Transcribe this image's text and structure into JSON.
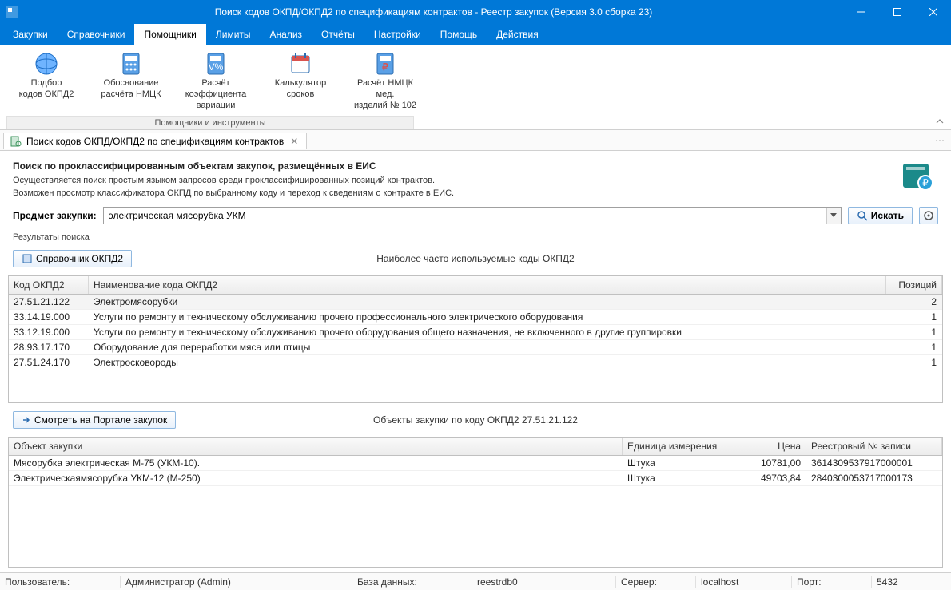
{
  "window": {
    "title": "Поиск кодов ОКПД/ОКПД2 по спецификациям контрактов - Реестр закупок (Версия 3.0 сборка 23)"
  },
  "menu": {
    "items": [
      "Закупки",
      "Справочники",
      "Помощники",
      "Лимиты",
      "Анализ",
      "Отчёты",
      "Настройки",
      "Помощь",
      "Действия"
    ],
    "active_index": 2
  },
  "ribbon": {
    "group_label": "Помощники и инструменты",
    "buttons": [
      {
        "label": "Подбор\nкодов ОКПД2"
      },
      {
        "label": "Обоснование\nрасчёта НМЦК"
      },
      {
        "label": "Расчёт коэффициента\nвариации"
      },
      {
        "label": "Калькулятор\nсроков"
      },
      {
        "label": "Расчёт НМЦК мед.\nизделий № 102"
      }
    ]
  },
  "tab": {
    "label": "Поиск кодов ОКПД/ОКПД2 по спецификациям контрактов"
  },
  "header": {
    "title": "Поиск по проклассифицированным объектам закупок, размещённых в ЕИС",
    "desc1": "Осуществляется поиск простым языком запросов среди проклассифицированных позиций контрактов.",
    "desc2": "Возможен просмотр классификатора ОКПД по выбранному коду и переход к сведениям о контракте в ЕИС."
  },
  "search": {
    "label": "Предмет закупки:",
    "value": "электрическая мясорубка УКМ",
    "button": "Искать"
  },
  "results": {
    "label": "Результаты поиска",
    "ref_button": "Справочник ОКПД2",
    "freq_label": "Наиболее часто используемые коды ОКПД2",
    "columns": {
      "code": "Код ОКПД2",
      "name": "Наименование кода ОКПД2",
      "pos": "Позиций"
    },
    "rows": [
      {
        "code": "27.51.21.122",
        "name": "Электромясорубки",
        "pos": "2"
      },
      {
        "code": "33.14.19.000",
        "name": "Услуги по ремонту и техническому обслуживанию прочего профессионального электрического оборудования",
        "pos": "1"
      },
      {
        "code": "33.12.19.000",
        "name": "Услуги по ремонту и техническому обслуживанию прочего оборудования общего назначения, не включенного в другие группировки",
        "pos": "1"
      },
      {
        "code": "28.93.17.170",
        "name": "Оборудование для переработки мяса или птицы",
        "pos": "1"
      },
      {
        "code": "27.51.24.170",
        "name": "Электросковороды",
        "pos": "1"
      }
    ]
  },
  "objects": {
    "portal_button": "Смотреть на Портале закупок",
    "title": "Объекты закупки по коду ОКПД2 27.51.21.122",
    "columns": {
      "obj": "Объект закупки",
      "unit": "Единица измерения",
      "price": "Цена",
      "reg": "Реестровый № записи"
    },
    "rows": [
      {
        "obj": "Мясорубка электрическая М-75 (УКМ-10).",
        "unit": "Штука",
        "price": "10781,00",
        "reg": "3614309537917000001"
      },
      {
        "obj": "Электрическаямясорубка УКМ-12 (М-250)",
        "unit": "Штука",
        "price": "49703,84",
        "reg": "2840300053717000173"
      }
    ]
  },
  "status": {
    "user_label": "Пользователь:",
    "user_value": "Администратор (Admin)",
    "db_label": "База данных:",
    "db_value": "reestrdb0",
    "server_label": "Сервер:",
    "server_value": "localhost",
    "port_label": "Порт:",
    "port_value": "5432"
  }
}
